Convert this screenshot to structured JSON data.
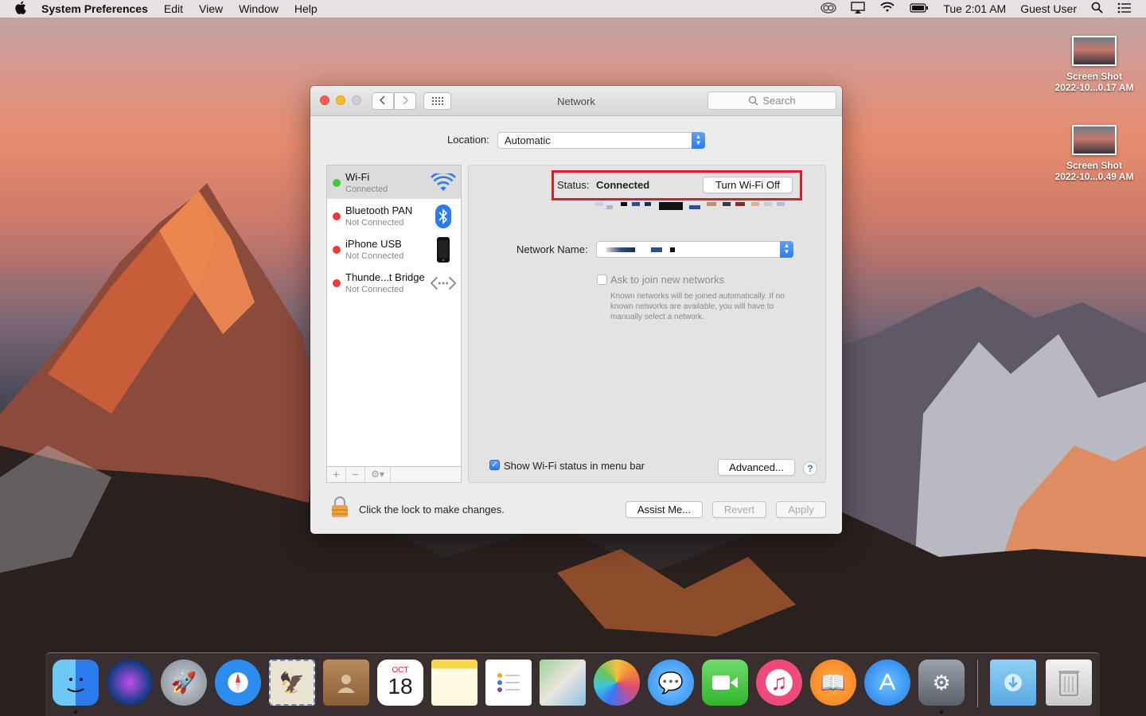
{
  "menubar": {
    "app_name": "System Preferences",
    "items": [
      "Edit",
      "View",
      "Window",
      "Help"
    ],
    "clock": "Tue 2:01 AM",
    "user": "Guest User"
  },
  "desktop": {
    "icons": [
      {
        "line1": "Screen Shot",
        "line2": "2022-10...0.17 AM"
      },
      {
        "line1": "Screen Shot",
        "line2": "2022-10...0.49 AM"
      }
    ]
  },
  "window": {
    "title": "Network",
    "search_placeholder": "Search",
    "location_label": "Location:",
    "location_value": "Automatic",
    "services": [
      {
        "name": "Wi-Fi",
        "status": "Connected",
        "dot_color": "#3ec745",
        "icon": "wifi-icon",
        "selected": true
      },
      {
        "name": "Bluetooth PAN",
        "status": "Not Connected",
        "dot_color": "#ee3b36",
        "icon": "bluetooth-icon",
        "selected": false
      },
      {
        "name": "iPhone USB",
        "status": "Not Connected",
        "dot_color": "#ee3b36",
        "icon": "iphone-icon",
        "selected": false
      },
      {
        "name": "Thunde...t Bridge",
        "status": "Not Connected",
        "dot_color": "#ee3b36",
        "icon": "thunderbolt-bridge-icon",
        "selected": false
      }
    ],
    "details": {
      "status_label": "Status:",
      "status_value": "Connected",
      "turn_off_button": "Turn Wi-Fi Off",
      "network_name_label": "Network Name:",
      "ask_to_join_label": "Ask to join new networks",
      "ask_to_join_checked": false,
      "ask_to_join_help": "Known networks will be joined automatically. If no known networks are available, you will have to manually select a network.",
      "show_status_label": "Show Wi-Fi status in menu bar",
      "show_status_checked": true,
      "advanced_button": "Advanced...",
      "help_button": "?"
    },
    "lock_text": "Click the lock to make changes.",
    "assist_button": "Assist Me...",
    "revert_button": "Revert",
    "apply_button": "Apply"
  },
  "dock": {
    "apps": [
      "Finder",
      "Siri",
      "Launchpad",
      "Safari",
      "Mail",
      "Contacts",
      "Calendar",
      "Notes",
      "Reminders",
      "Maps",
      "Photos",
      "Messages",
      "FaceTime",
      "iTunes",
      "iBooks",
      "App Store",
      "System Preferences",
      "Downloads",
      "Trash"
    ],
    "calendar_month": "OCT",
    "calendar_day": "18"
  },
  "colors": {
    "highlight_box": "#e21c26",
    "accent": "#2a7bee"
  }
}
